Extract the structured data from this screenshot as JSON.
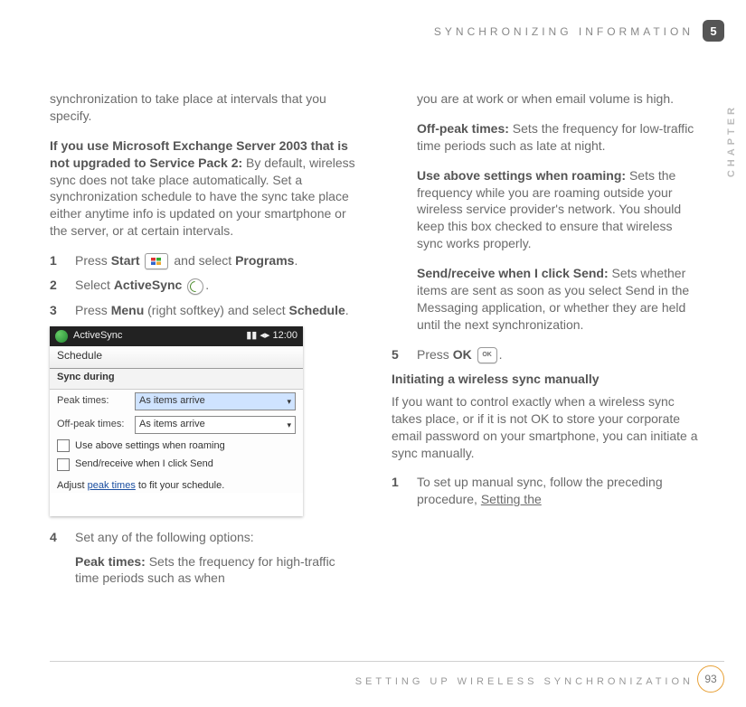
{
  "header": {
    "title": "SYNCHRONIZING INFORMATION",
    "chapter_number": "5",
    "side_label": "CHAPTER"
  },
  "footer": {
    "title": "SETTING UP WIRELESS SYNCHRONIZATION",
    "page_number": "93"
  },
  "left": {
    "p1": "synchronization to take place at intervals that you specify.",
    "p2_bold": "If you use Microsoft Exchange Server 2003 that is not upgraded to Service Pack 2:",
    "p2_rest": " By default, wireless sync does not take place automatically. Set a synchronization schedule to have the sync take place either anytime info is updated on your smartphone or the server, or at certain intervals.",
    "s1_num": "1",
    "s1_a": "Press ",
    "s1_b": "Start",
    "s1_c": " and select ",
    "s1_d": "Programs",
    "s1_e": ".",
    "s2_num": "2",
    "s2_a": "Select ",
    "s2_b": "ActiveSync",
    "s2_c": ".",
    "s3_num": "3",
    "s3_a": "Press ",
    "s3_b": "Menu",
    "s3_c": " (right softkey) and select ",
    "s3_d": "Schedule",
    "s3_e": ".",
    "s4_num": "4",
    "s4_a": "Set any of the following options:",
    "s4_peak_label": "Peak times:",
    "s4_peak_text": " Sets the frequency for high-traffic time periods such as when"
  },
  "screenshot": {
    "app": "ActiveSync",
    "signal": "▮▮ ◂▸ 12:00",
    "tab": "Schedule",
    "section": "Sync during",
    "row1_label": "Peak times:",
    "row1_value": "As items arrive",
    "row2_label": "Off-peak times:",
    "row2_value": "As items arrive",
    "chk1": "Use above settings when roaming",
    "chk2": "Send/receive when I click Send",
    "footer_a": "Adjust ",
    "footer_link": "peak times",
    "footer_b": " to fit your schedule."
  },
  "right": {
    "p1": "you are at work or when email volume is high.",
    "offpeak_label": "Off-peak times:",
    "offpeak_text": " Sets the frequency for low-traffic time periods such as late at night.",
    "roam_label": "Use above settings when roaming:",
    "roam_text": " Sets the frequency while you are roaming outside your wireless service provider's network. You should keep this box checked to ensure that wireless sync works properly.",
    "send_label": "Send/receive when I click Send:",
    "send_text": " Sets whether items are sent as soon as you select Send in the Messaging application, or whether they are held until the next synchronization.",
    "s5_num": "5",
    "s5_a": "Press ",
    "s5_b": "OK",
    "s5_c": ".",
    "subhead": "Initiating a wireless sync manually",
    "sub_p": "If you want to control exactly when a wireless sync takes place, or if it is not OK to store your corporate email password on your smartphone, you can initiate a sync manually.",
    "s1_num": "1",
    "s1_a": "To set up manual sync, follow the preceding procedure, ",
    "s1_link": "Setting the"
  }
}
